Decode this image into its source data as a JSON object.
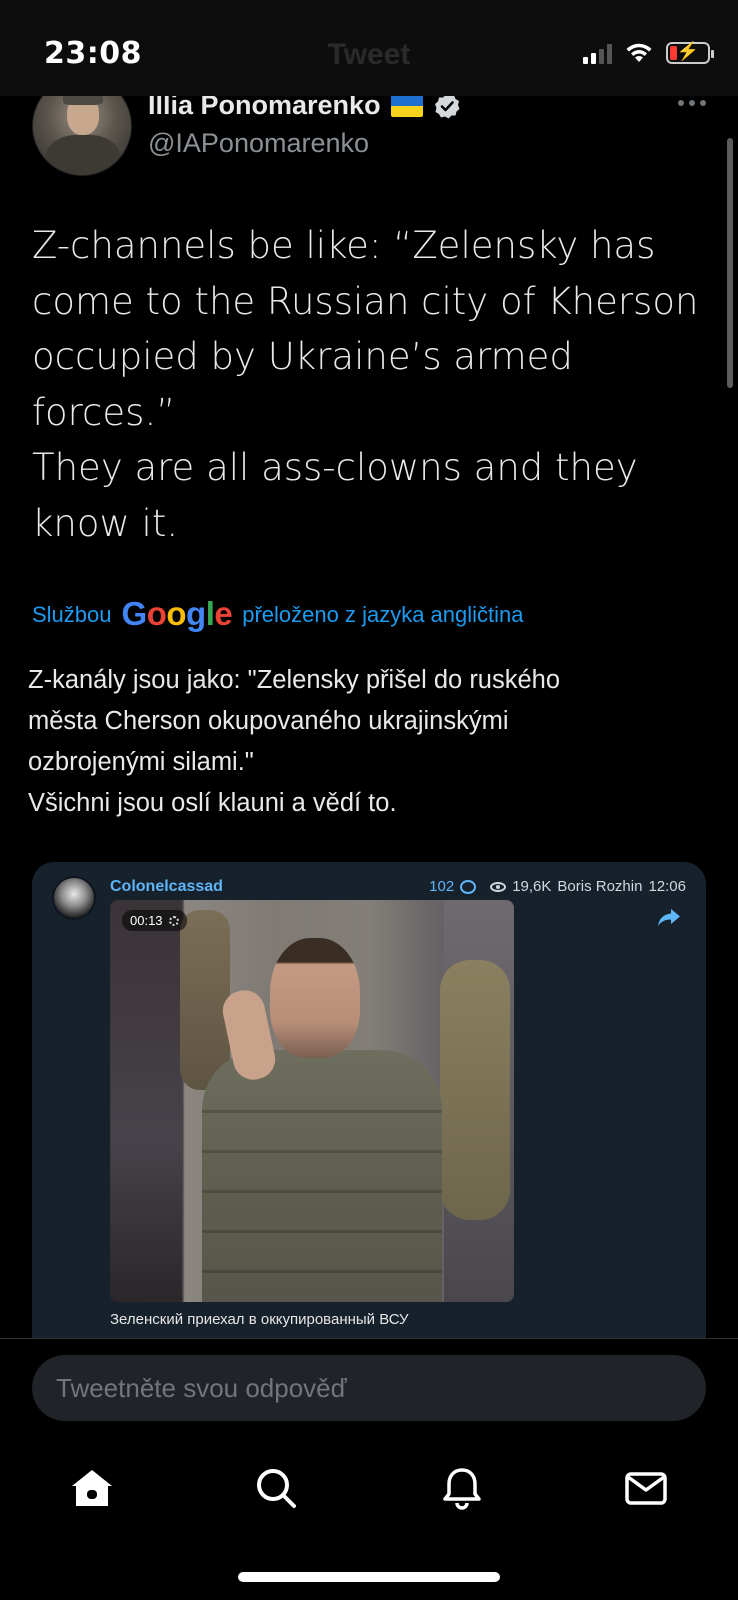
{
  "status_bar": {
    "time": "23:08",
    "ghost_title": "Tweet",
    "battery_level": 0.2,
    "icons": [
      "cellular-signal-icon",
      "wifi-icon",
      "battery-charging-icon"
    ]
  },
  "author": {
    "name": "Illia Ponomarenko",
    "handle": "@IAPonomarenko",
    "flag": "ukraine-flag-icon",
    "verified": true
  },
  "tweet": {
    "text": "Z-channels be like: “Zelensky has\ncome to the Russian city of Kherson\noccupied by Ukraine’s armed\nforces.”\nThey are all ass-clowns and they\nknow it."
  },
  "translation": {
    "prefix": "Službou",
    "google_letters": [
      "G",
      "o",
      "o",
      "g",
      "l",
      "e"
    ],
    "suffix": "přeloženo z jazyka angličtina",
    "text": "Z-kanály jsou jako: \"Zelensky přišel do ruského\nměsta Cherson okupovaného ukrajinskými\nozbrojenými silami.\"\nVšichni jsou oslí klauni a vědí to."
  },
  "media_card": {
    "channel_name": "Colonelcassad",
    "replies": "102",
    "views": "19,6K",
    "author": "Boris Rozhin",
    "time": "12:06",
    "video_duration": "00:13",
    "caption": "Зеленский приехал в оккупированный ВСУ"
  },
  "reply": {
    "placeholder": "Tweetněte svou odpověď"
  },
  "nav": {
    "items": [
      "home-icon",
      "search-icon",
      "notifications-icon",
      "messages-icon"
    ]
  },
  "colors": {
    "accent": "#1d9bf0",
    "background": "#000000",
    "card_background": "#17212b",
    "telegram_link": "#5eb5f7"
  }
}
